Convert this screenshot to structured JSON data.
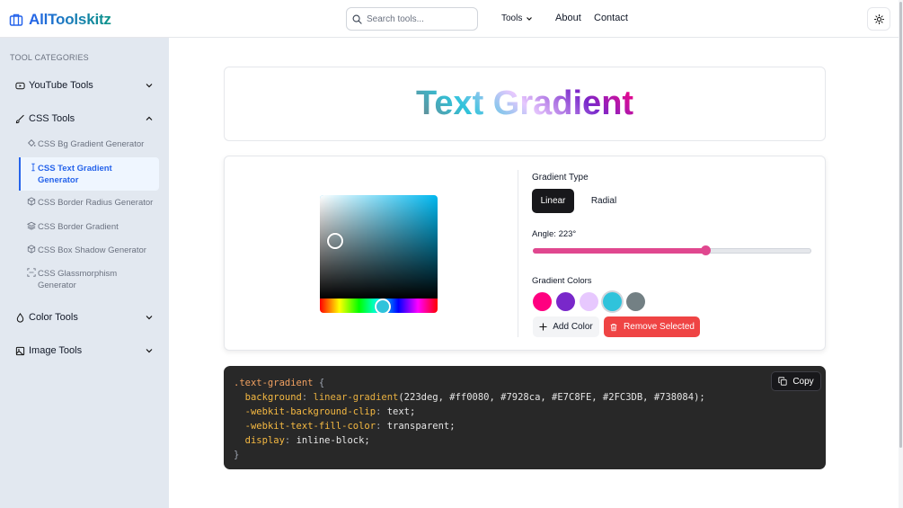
{
  "header": {
    "logo_text": "AllToolskitz",
    "search_placeholder": "Search tools...",
    "nav": {
      "tools": "Tools",
      "about": "About",
      "contact": "Contact"
    }
  },
  "sidebar": {
    "heading": "TOOL CATEGORIES",
    "categories": [
      {
        "label": "YouTube Tools",
        "icon": "youtube-icon",
        "expanded": false
      },
      {
        "label": "CSS Tools",
        "icon": "brush-icon",
        "expanded": true,
        "items": [
          {
            "label": "CSS Bg Gradient Generator",
            "icon": "paint-bucket-icon"
          },
          {
            "label": "CSS Text Gradient Generator",
            "icon": "text-cursor-icon",
            "active": true
          },
          {
            "label": "CSS Border Radius Generator",
            "icon": "box-icon"
          },
          {
            "label": "CSS Border Gradient",
            "icon": "layers-icon"
          },
          {
            "label": "CSS Box Shadow Generator",
            "icon": "box-icon"
          },
          {
            "label": "CSS Glassmorphism Generator",
            "icon": "scan-icon"
          }
        ]
      },
      {
        "label": "Color Tools",
        "icon": "droplet-icon",
        "expanded": false
      },
      {
        "label": "Image Tools",
        "icon": "image-icon",
        "expanded": false
      }
    ]
  },
  "preview": {
    "text": "Text Gradient"
  },
  "editor": {
    "gradient_type_label": "Gradient Type",
    "types": {
      "linear": "Linear",
      "radial": "Radial"
    },
    "selected_type": "Linear",
    "angle_label": "Angle: 223°",
    "angle_value": 223,
    "angle_fraction": 0.62,
    "colors_label": "Gradient Colors",
    "colors": [
      "#ff0080",
      "#7928ca",
      "#E7C8FE",
      "#2FC3DB",
      "#738084"
    ],
    "selected_color": "#2FC3DB",
    "add_color_label": "Add Color",
    "remove_selected_label": "Remove Selected"
  },
  "code": {
    "copy_label": "Copy",
    "lines": {
      "l1_selector": ".text-gradient",
      "l1_brace": " {",
      "l2_prop": "background",
      "l2_fn": "linear-gradient",
      "l2_args": "(223deg, #ff0080, #7928ca, #E7C8FE, #2FC3DB, #738084);",
      "l3_prop": "-webkit-background-clip",
      "l3_val": " text;",
      "l4_prop": "-webkit-text-fill-color",
      "l4_val": " transparent;",
      "l5_prop": "display",
      "l5_val": " inline-block;",
      "l6": "}"
    }
  },
  "colors": {
    "accent": "#2563eb",
    "danger": "#ef4444",
    "slider": "#e0478f",
    "code_bg": "#282828"
  }
}
